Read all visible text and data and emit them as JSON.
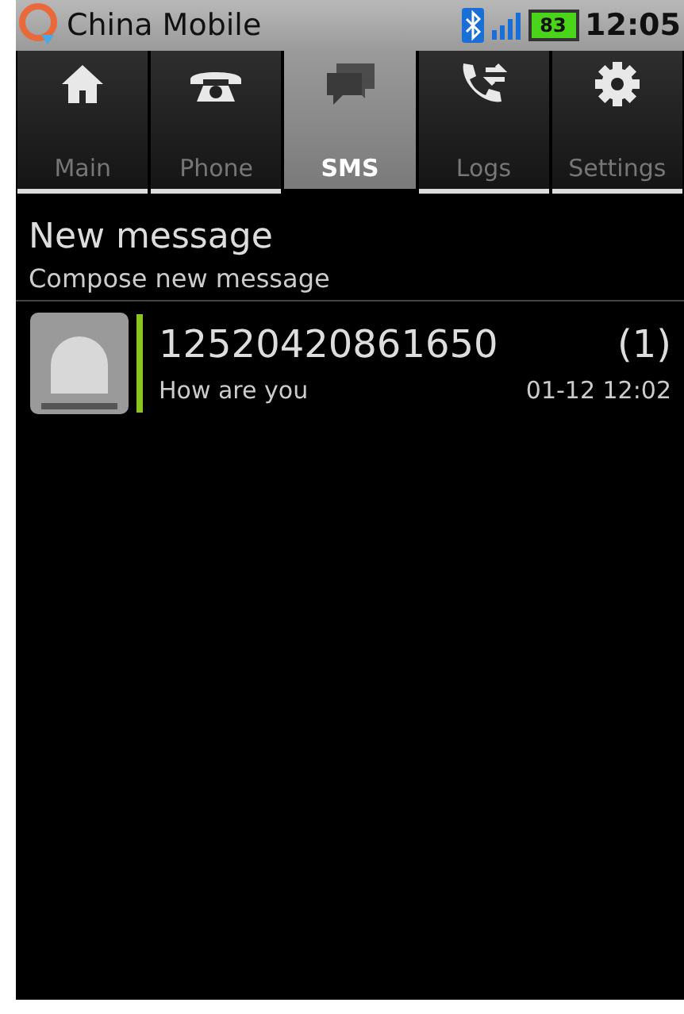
{
  "status_bar": {
    "carrier": "China Mobile",
    "battery": "83",
    "time": "12:05"
  },
  "tabs": [
    {
      "label": "Main",
      "selected": false
    },
    {
      "label": "Phone",
      "selected": false
    },
    {
      "label": "SMS",
      "selected": true
    },
    {
      "label": "Logs",
      "selected": false
    },
    {
      "label": "Settings",
      "selected": false
    }
  ],
  "new_message": {
    "title": "New message",
    "subtitle": "Compose new message"
  },
  "conversations": [
    {
      "sender": "12520420861650",
      "count": "(1)",
      "preview": "How are you",
      "time": "01-12 12:02",
      "unread": true
    }
  ]
}
